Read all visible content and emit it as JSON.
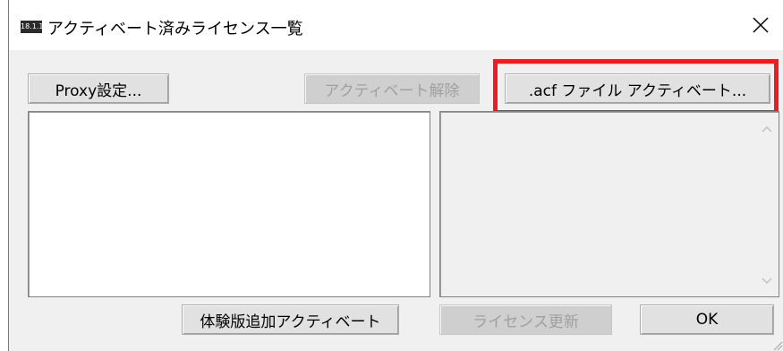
{
  "window": {
    "title": "アクティベート済みライセンス一覧",
    "app_icon_text": "18.1.1"
  },
  "buttons": {
    "proxy": "Proxy設定...",
    "deactivate": "アクティベート解除",
    "acf_activate": ".acf ファイル アクティベート...",
    "trial_activate": "体験版追加アクティベート",
    "license_update": "ライセンス更新",
    "ok": "OK"
  },
  "icons": {
    "close": "close-icon",
    "scroll_up": "scroll-up-arrow-icon",
    "scroll_down": "scroll-down-arrow-icon"
  },
  "colors": {
    "highlight": "#ec1c24"
  }
}
